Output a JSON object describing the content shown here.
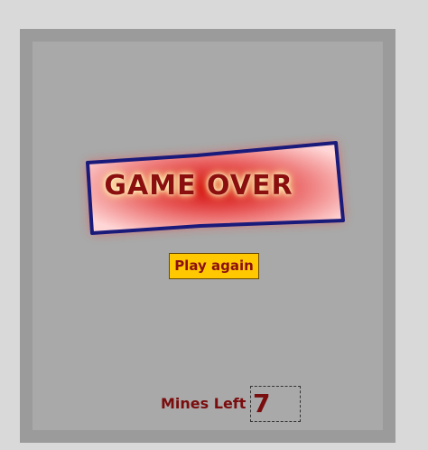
{
  "banner": {
    "title": "GAME OVER"
  },
  "controls": {
    "play_again_label": "Play again"
  },
  "status": {
    "mines_left_label": "Mines Left",
    "mines_left_count": "7"
  },
  "colors": {
    "background": "#d9d9d9",
    "frame": "#9b9b9b",
    "board": "#a9a9a9",
    "banner_border": "#1a1a7a",
    "banner_fill_center": "#d10000",
    "banner_fill_edge": "#ffd0d0",
    "button_fill": "#ffc800",
    "text_dark_red": "#8b0f0f"
  }
}
